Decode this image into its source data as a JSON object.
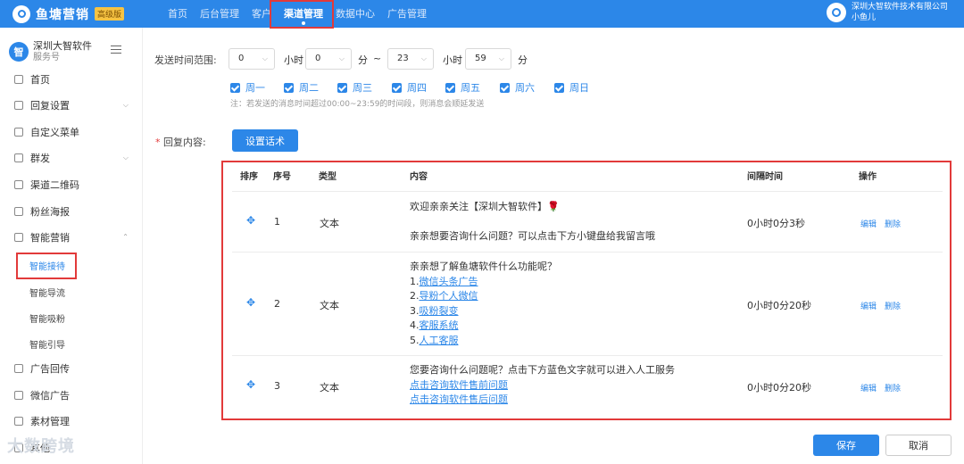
{
  "topbar": {
    "brand": "鱼塘营销",
    "badge": "高级版",
    "nav": [
      "首页",
      "后台管理",
      "客户",
      "渠道管理",
      "数据中心",
      "广告管理"
    ],
    "account_company": "深圳大智软件技术有限公司",
    "account_user": "小鱼儿"
  },
  "sidebar": {
    "logo_char": "智",
    "title": "深圳大智软件",
    "subtitle": "服务号",
    "items": {
      "home": "首页",
      "reply": "回复设置",
      "menu": "自定义菜单",
      "mass": "群发",
      "qrcode": "渠道二维码",
      "poster": "粉丝海报",
      "marketing": "智能营销",
      "ad_return": "广告回传",
      "wechat_ad": "微信广告",
      "material": "素材管理",
      "other": "其他"
    },
    "sub_items": {
      "reception": "智能接待",
      "guide": "智能导流",
      "fans": "智能吸粉",
      "lead": "智能引导"
    }
  },
  "form": {
    "time_label": "发送时间范围:",
    "start_hour": "0",
    "start_minute": "0",
    "end_hour": "23",
    "end_minute": "59",
    "unit_hour": "小时",
    "unit_minute": "分",
    "range_sep": "~",
    "days": [
      "周一",
      "周二",
      "周三",
      "周四",
      "周五",
      "周六",
      "周日"
    ],
    "note": "注：若发送的消息时间超过00:00~23:59的时间段，则消息会顺延发送",
    "reply_label": "回复内容:",
    "set_script_button": "设置话术"
  },
  "table": {
    "headers": {
      "sort": "排序",
      "index": "序号",
      "type": "类型",
      "content": "内容",
      "interval": "间隔时间",
      "action": "操作"
    },
    "edit": "编辑",
    "delete": "删除",
    "rows": [
      {
        "index": "1",
        "type": "文本",
        "line1": "欢迎亲亲关注【深圳大智软件】🌹",
        "line2": "亲亲想要咨询什么问题？可以点击下方小键盘给我留言哦",
        "interval": "0小时0分3秒"
      },
      {
        "index": "2",
        "type": "文本",
        "line1": "亲亲想了解鱼塘软件什么功能呢？",
        "items": [
          {
            "prefix": "1.",
            "link": "微信头条广告"
          },
          {
            "prefix": "2.",
            "link": "导粉个人微信"
          },
          {
            "prefix": "3.",
            "link": "吸粉裂变"
          },
          {
            "prefix": "4.",
            "link": "客服系统"
          },
          {
            "prefix": "5.",
            "link": "人工客服"
          }
        ],
        "interval": "0小时0分20秒"
      },
      {
        "index": "3",
        "type": "文本",
        "line1": "您要咨询什么问题呢？点击下方蓝色文字就可以进入人工服务",
        "link1": "点击咨询软件售前问题",
        "link2": "点击咨询软件售后问题",
        "interval": "0小时0分20秒"
      }
    ]
  },
  "footer": {
    "save": "保存",
    "cancel": "取消"
  },
  "watermark": "大数跨境"
}
